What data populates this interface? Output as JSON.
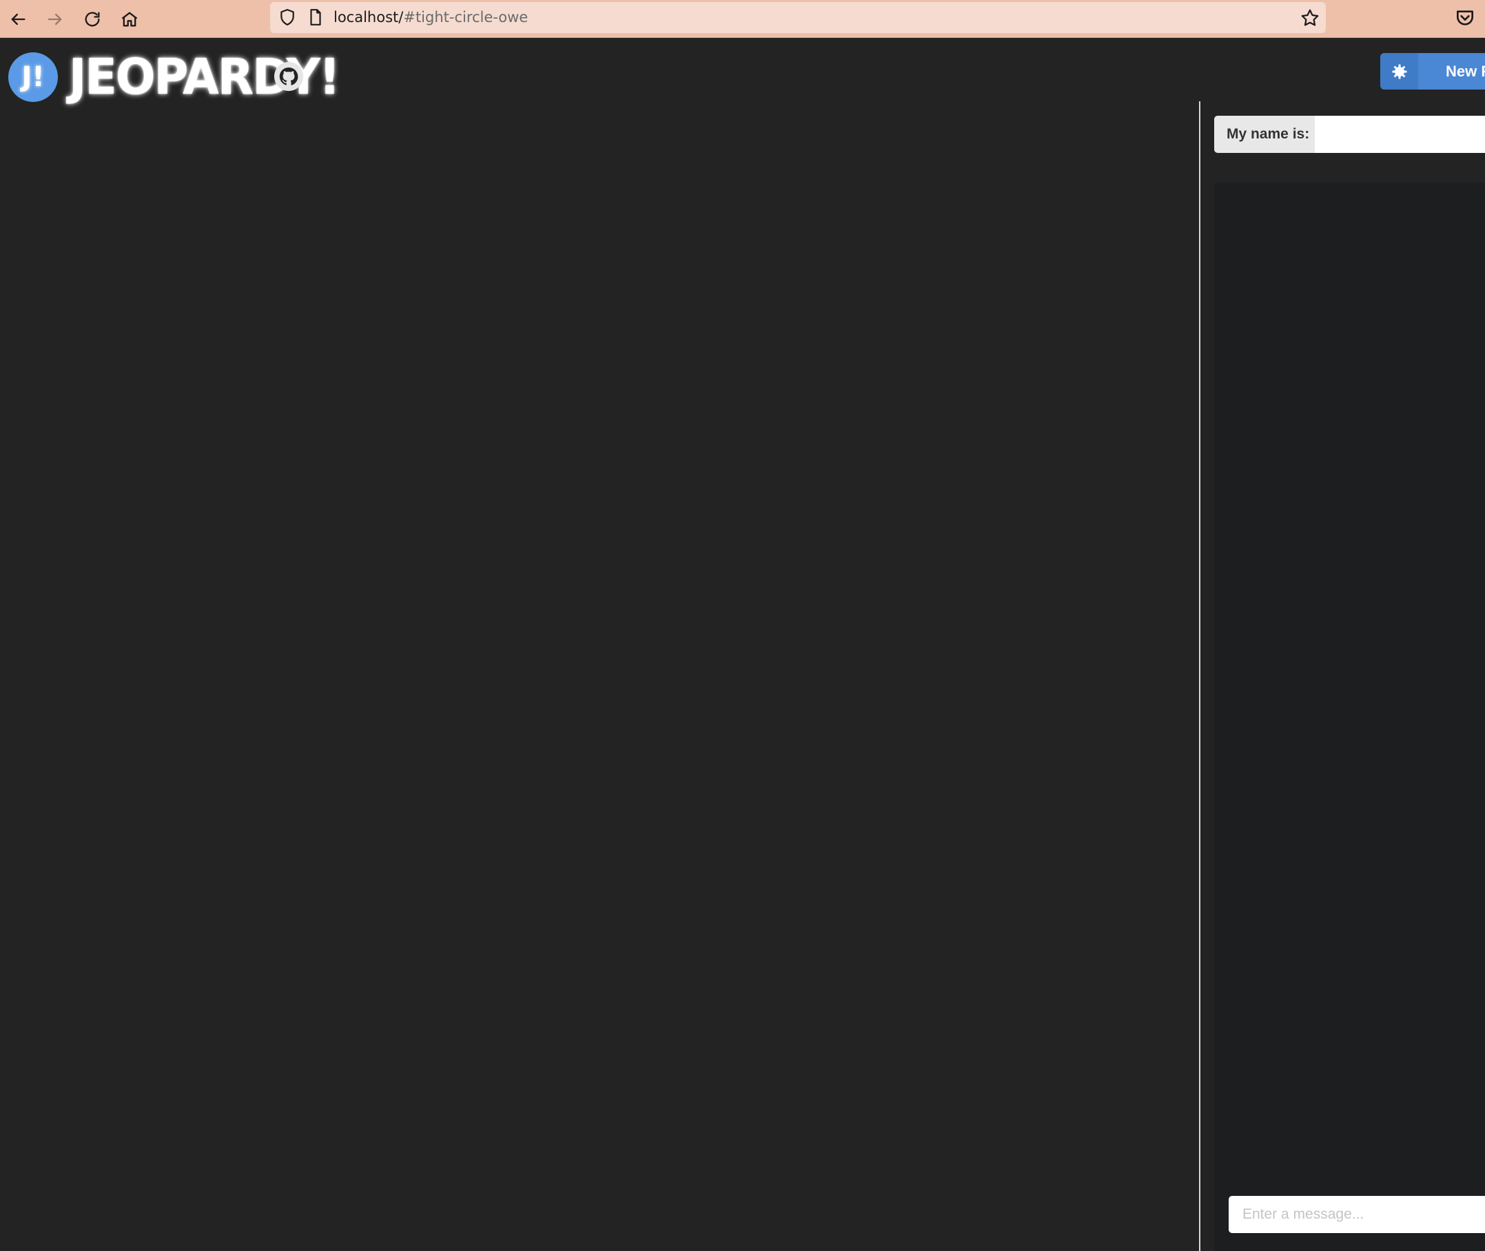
{
  "browser": {
    "url_host": "localhost/",
    "url_fragment": "#tight-circle-owe"
  },
  "header": {
    "logo_letter": "J!",
    "title": "JEOPARDY!",
    "new_room_label": "New R"
  },
  "sidebar": {
    "name_label": "My name is:",
    "name_value": "",
    "chat_placeholder": "Enter a message..."
  },
  "colors": {
    "browser_bar": "#eec0aa",
    "page_background": "#232323",
    "accent_blue": "#4a87d4",
    "logo_circle": "#5a9ae6"
  },
  "icons": [
    "back-icon",
    "forward-icon",
    "reload-icon",
    "home-icon",
    "shield-icon",
    "page-icon",
    "star-icon",
    "pocket-icon",
    "github-icon",
    "gear-icon"
  ]
}
